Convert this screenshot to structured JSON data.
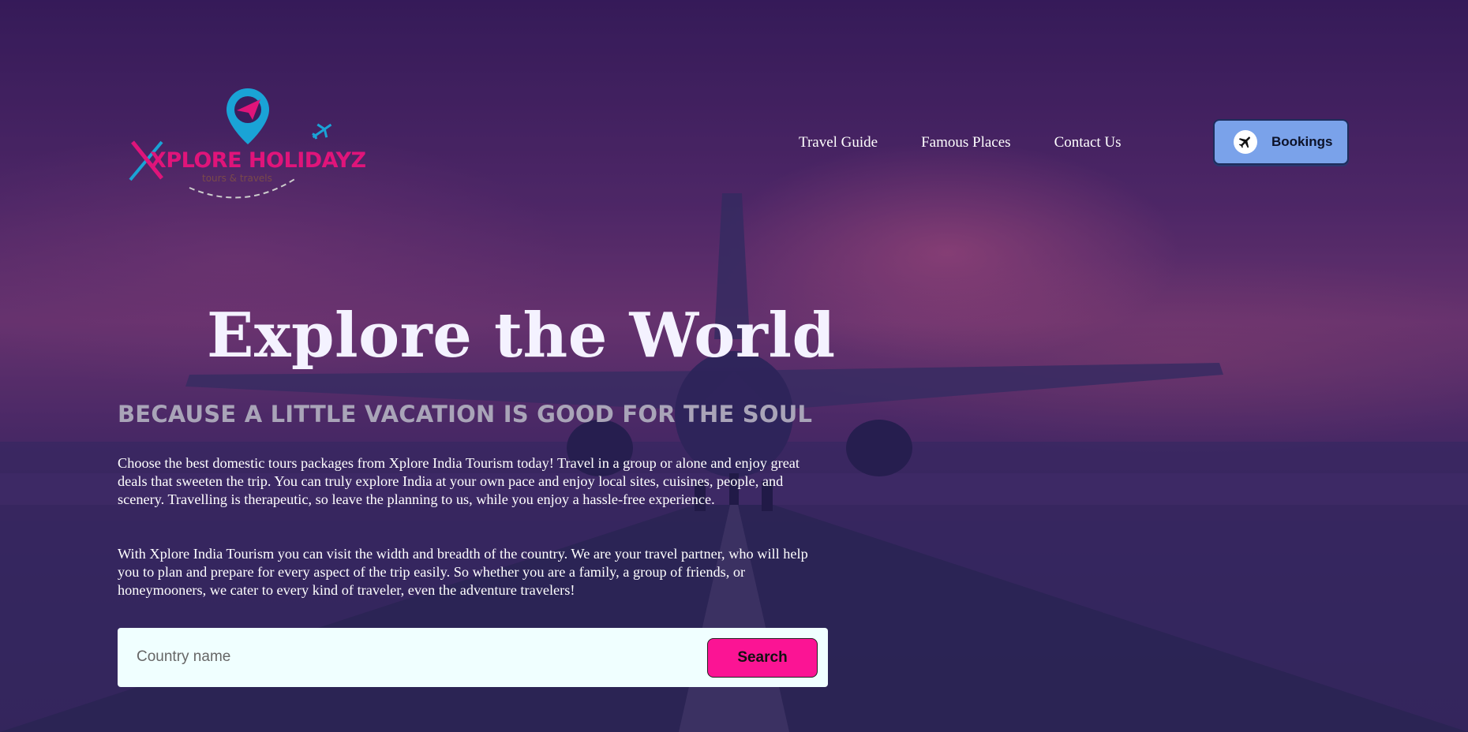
{
  "brand": {
    "name": "XPLORE HOLIDAYZ",
    "tagline": "tours & travels"
  },
  "nav": {
    "items": [
      "Travel Guide",
      "Famous Places",
      "Contact Us"
    ],
    "bookings_label": "Bookings"
  },
  "hero": {
    "title": "Explore the World",
    "tagline": "BECAUSE A LITTLE VACATION IS GOOD FOR THE SOUL",
    "paragraph_1": "Choose the best domestic tours packages from Xplore India Tourism today! Travel in a group or alone and enjoy great deals that sweeten the trip. You can truly explore India at your own pace and enjoy local sites, cuisines, people, and scenery. Travelling is therapeutic, so leave the planning to us, while you enjoy a hassle-free experience.",
    "paragraph_2": "With Xplore India Tourism you can visit the width and breadth of the country. We are your travel partner, who will help you to plan and prepare for every aspect of the trip easily. So whether you are a family, a group of friends, or honeymooners, we cater to every kind of traveler, even the adventure travelers!"
  },
  "search": {
    "placeholder": "Country name",
    "button_label": "Search"
  },
  "colors": {
    "logo_pink": "#e0147a",
    "logo_blue": "#1aa3d6",
    "bookings_bg": "#7aa2ea",
    "search_button": "#fb1494",
    "search_bg": "#f0ffff"
  },
  "icons": {
    "bookings": "airplane-icon",
    "logo_pin": "map-pin-icon"
  }
}
